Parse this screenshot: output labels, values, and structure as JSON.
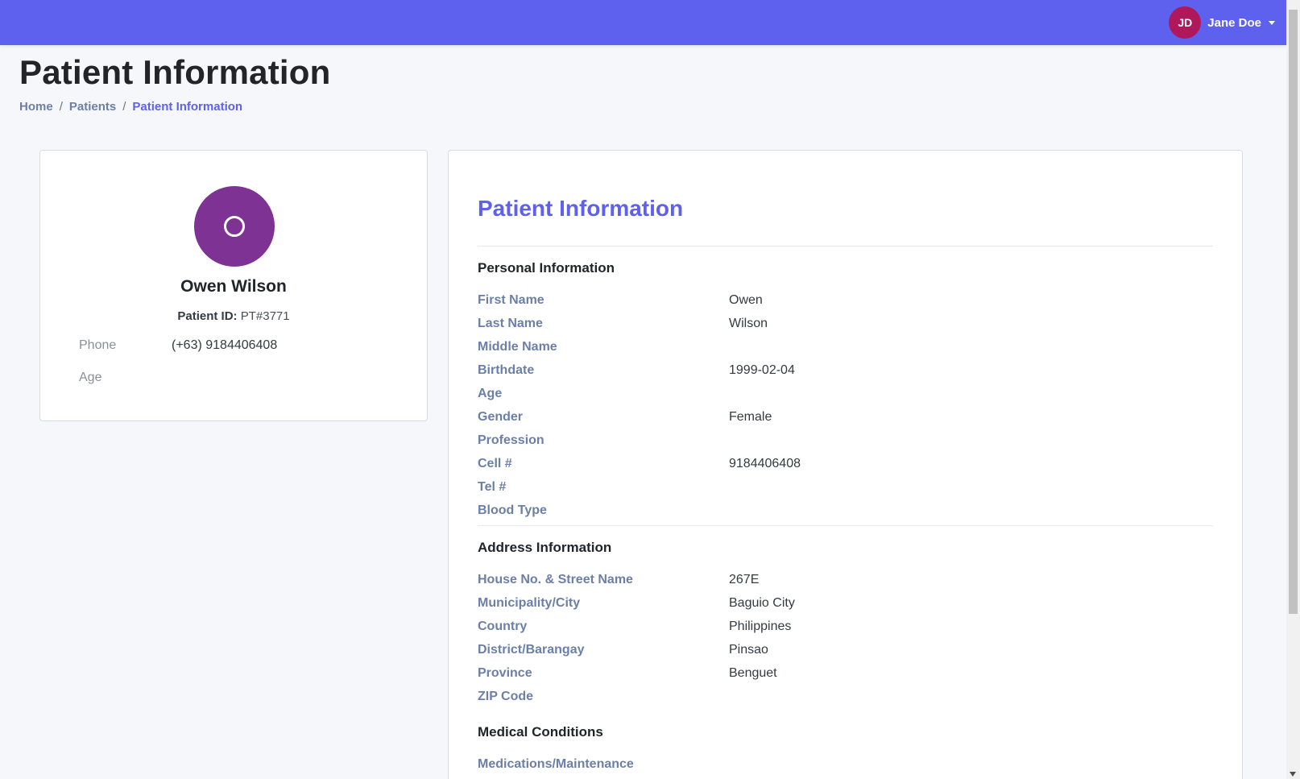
{
  "topbar": {
    "user_initials": "JD",
    "user_name": "Jane Doe",
    "bg_color": "#5e61ee"
  },
  "page": {
    "title": "Patient Information",
    "breadcrumb": [
      "Home",
      "Patients",
      "Patient Information"
    ]
  },
  "profile": {
    "avatar_letter_icon": "circle-icon",
    "name": "Owen Wilson",
    "patient_id_label": "Patient ID:",
    "patient_id_value": "PT#3771",
    "phone_label": "Phone",
    "phone_value": "(+63) 9184406408",
    "age_label": "Age",
    "age_value": ""
  },
  "details": {
    "title": "Patient Information",
    "personal": {
      "heading": "Personal Information",
      "fields": [
        {
          "label": "First Name",
          "value": "Owen"
        },
        {
          "label": "Last Name",
          "value": "Wilson"
        },
        {
          "label": "Middle Name",
          "value": ""
        },
        {
          "label": "Birthdate",
          "value": "1999-02-04"
        },
        {
          "label": "Age",
          "value": ""
        },
        {
          "label": "Gender",
          "value": "Female"
        },
        {
          "label": "Profession",
          "value": ""
        },
        {
          "label": "Cell #",
          "value": "9184406408"
        },
        {
          "label": "Tel #",
          "value": ""
        },
        {
          "label": "Blood Type",
          "value": ""
        }
      ]
    },
    "address": {
      "heading": "Address Information",
      "fields": [
        {
          "label": "House No. & Street Name",
          "value": "267E"
        },
        {
          "label": "Municipality/City",
          "value": "Baguio City"
        },
        {
          "label": "Country",
          "value": "Philippines"
        },
        {
          "label": "District/Barangay",
          "value": "Pinsao"
        },
        {
          "label": "Province",
          "value": "Benguet"
        },
        {
          "label": "ZIP Code",
          "value": ""
        }
      ]
    },
    "medical": {
      "heading": "Medical Conditions",
      "fields": [
        {
          "label": "Medications/Maintenance",
          "value": ""
        }
      ]
    }
  }
}
